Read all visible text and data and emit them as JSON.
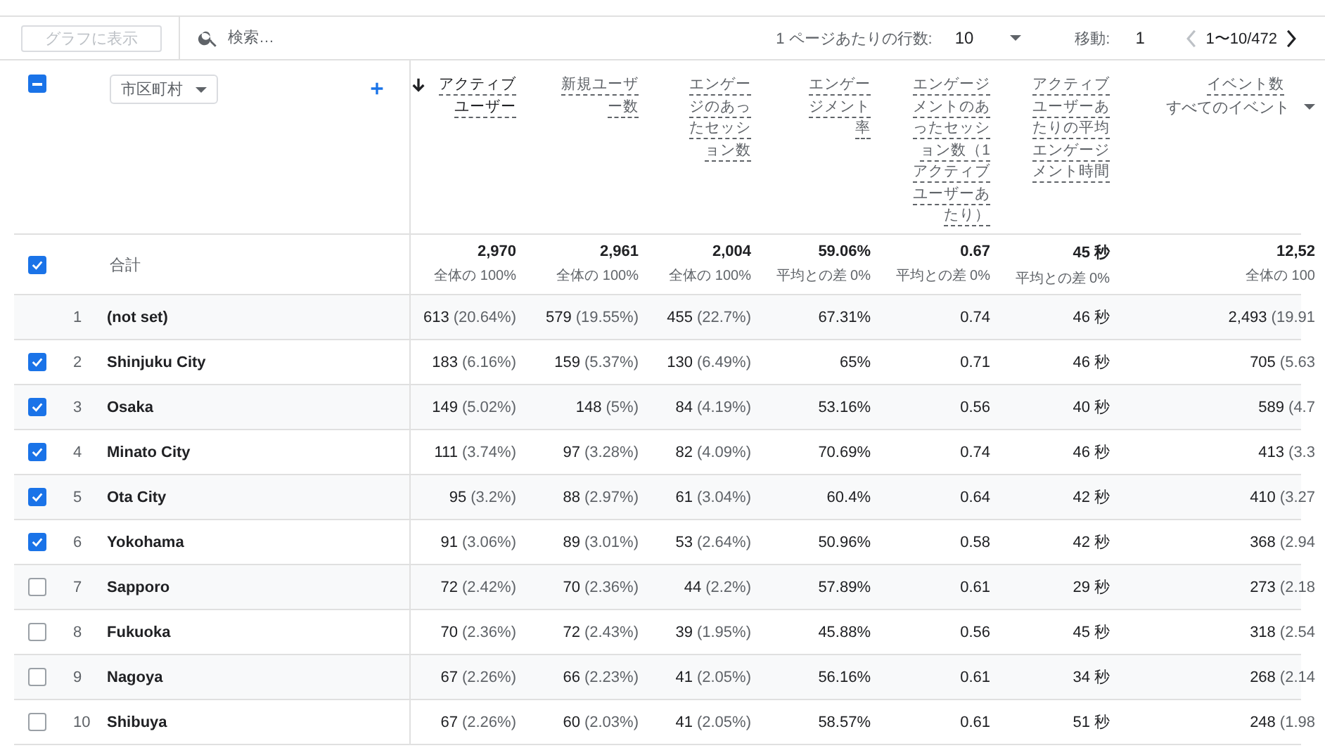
{
  "toolbar": {
    "chart_button": {
      "label": "グラフに表示",
      "disabled": true
    },
    "search": {
      "placeholder": "検索…"
    },
    "pagination": {
      "rows_label": "1 ページあたりの行数:",
      "rows_value": "10",
      "goto_label": "移動:",
      "goto_value": "1",
      "range": "1〜10/472",
      "prev_disabled": true
    }
  },
  "table": {
    "header_checked": true,
    "header_indeterminate": true,
    "dimension": "市区町村",
    "columns": [
      {
        "label": "アクティブユーザー",
        "sorted": true
      },
      {
        "label": "新規ユーザー数",
        "sorted": false
      },
      {
        "label": "エンゲージのあったセッション数",
        "sorted": false
      },
      {
        "label": "エンゲージメント率",
        "sorted": false
      },
      {
        "label": "エンゲージメントのあったセッション数（1アクティブユーザーあたり）",
        "sorted": false
      },
      {
        "label": "アクティブユーザーあたりの平均エンゲージメント時間",
        "sorted": false
      },
      {
        "label": "イベント数",
        "sorted": false,
        "selector": "すべてのイベント"
      }
    ],
    "totals": {
      "label": "合計",
      "checked": true,
      "values": [
        {
          "value": "2,970",
          "note": "全体の 100%"
        },
        {
          "value": "2,961",
          "note": "全体の 100%"
        },
        {
          "value": "2,004",
          "note": "全体の 100%"
        },
        {
          "value": "59.06%",
          "note": "平均との差 0%"
        },
        {
          "value": "0.67",
          "note": "平均との差 0%"
        },
        {
          "value": "45 秒",
          "note": "平均との差 0%"
        },
        {
          "value": "12,52",
          "note": "全体の 100"
        }
      ]
    },
    "rows": [
      {
        "index": "1",
        "name": "(not set)",
        "cells": [
          {
            "value": "613",
            "share": "(20.64%)"
          },
          {
            "value": "579",
            "share": "(19.55%)"
          },
          {
            "value": "455",
            "share": "(22.7%)"
          },
          {
            "value": "67.31%"
          },
          {
            "value": "0.74"
          },
          {
            "value": "46 秒"
          },
          {
            "value": "2,493",
            "share": "(19.91"
          }
        ]
      },
      {
        "index": "2",
        "name": "Shinjuku City",
        "checked": true,
        "cells": [
          {
            "value": "183",
            "share": "(6.16%)"
          },
          {
            "value": "159",
            "share": "(5.37%)"
          },
          {
            "value": "130",
            "share": "(6.49%)"
          },
          {
            "value": "65%"
          },
          {
            "value": "0.71"
          },
          {
            "value": "46 秒"
          },
          {
            "value": "705",
            "share": "(5.63"
          }
        ]
      },
      {
        "index": "3",
        "name": "Osaka",
        "checked": true,
        "cells": [
          {
            "value": "149",
            "share": "(5.02%)"
          },
          {
            "value": "148",
            "share": "(5%)"
          },
          {
            "value": "84",
            "share": "(4.19%)"
          },
          {
            "value": "53.16%"
          },
          {
            "value": "0.56"
          },
          {
            "value": "40 秒"
          },
          {
            "value": "589",
            "share": "(4.7"
          }
        ]
      },
      {
        "index": "4",
        "name": "Minato City",
        "checked": true,
        "cells": [
          {
            "value": "111",
            "share": "(3.74%)"
          },
          {
            "value": "97",
            "share": "(3.28%)"
          },
          {
            "value": "82",
            "share": "(4.09%)"
          },
          {
            "value": "70.69%"
          },
          {
            "value": "0.74"
          },
          {
            "value": "46 秒"
          },
          {
            "value": "413",
            "share": "(3.3"
          }
        ]
      },
      {
        "index": "5",
        "name": "Ota City",
        "checked": true,
        "cells": [
          {
            "value": "95",
            "share": "(3.2%)"
          },
          {
            "value": "88",
            "share": "(2.97%)"
          },
          {
            "value": "61",
            "share": "(3.04%)"
          },
          {
            "value": "60.4%"
          },
          {
            "value": "0.64"
          },
          {
            "value": "42 秒"
          },
          {
            "value": "410",
            "share": "(3.27"
          }
        ]
      },
      {
        "index": "6",
        "name": "Yokohama",
        "checked": true,
        "cells": [
          {
            "value": "91",
            "share": "(3.06%)"
          },
          {
            "value": "89",
            "share": "(3.01%)"
          },
          {
            "value": "53",
            "share": "(2.64%)"
          },
          {
            "value": "50.96%"
          },
          {
            "value": "0.58"
          },
          {
            "value": "42 秒"
          },
          {
            "value": "368",
            "share": "(2.94"
          }
        ]
      },
      {
        "index": "7",
        "name": "Sapporo",
        "checked": false,
        "cells": [
          {
            "value": "72",
            "share": "(2.42%)"
          },
          {
            "value": "70",
            "share": "(2.36%)"
          },
          {
            "value": "44",
            "share": "(2.2%)"
          },
          {
            "value": "57.89%"
          },
          {
            "value": "0.61"
          },
          {
            "value": "29 秒"
          },
          {
            "value": "273",
            "share": "(2.18"
          }
        ]
      },
      {
        "index": "8",
        "name": "Fukuoka",
        "checked": false,
        "cells": [
          {
            "value": "70",
            "share": "(2.36%)"
          },
          {
            "value": "72",
            "share": "(2.43%)"
          },
          {
            "value": "39",
            "share": "(1.95%)"
          },
          {
            "value": "45.88%"
          },
          {
            "value": "0.56"
          },
          {
            "value": "45 秒"
          },
          {
            "value": "318",
            "share": "(2.54"
          }
        ]
      },
      {
        "index": "9",
        "name": "Nagoya",
        "checked": false,
        "cells": [
          {
            "value": "67",
            "share": "(2.26%)"
          },
          {
            "value": "66",
            "share": "(2.23%)"
          },
          {
            "value": "41",
            "share": "(2.05%)"
          },
          {
            "value": "56.16%"
          },
          {
            "value": "0.61"
          },
          {
            "value": "34 秒"
          },
          {
            "value": "268",
            "share": "(2.14"
          }
        ]
      },
      {
        "index": "10",
        "name": "Shibuya",
        "checked": false,
        "cells": [
          {
            "value": "67",
            "share": "(2.26%)"
          },
          {
            "value": "60",
            "share": "(2.03%)"
          },
          {
            "value": "41",
            "share": "(2.05%)"
          },
          {
            "value": "58.57%"
          },
          {
            "value": "0.61"
          },
          {
            "value": "51 秒"
          },
          {
            "value": "248",
            "share": "(1.98"
          }
        ]
      }
    ]
  }
}
